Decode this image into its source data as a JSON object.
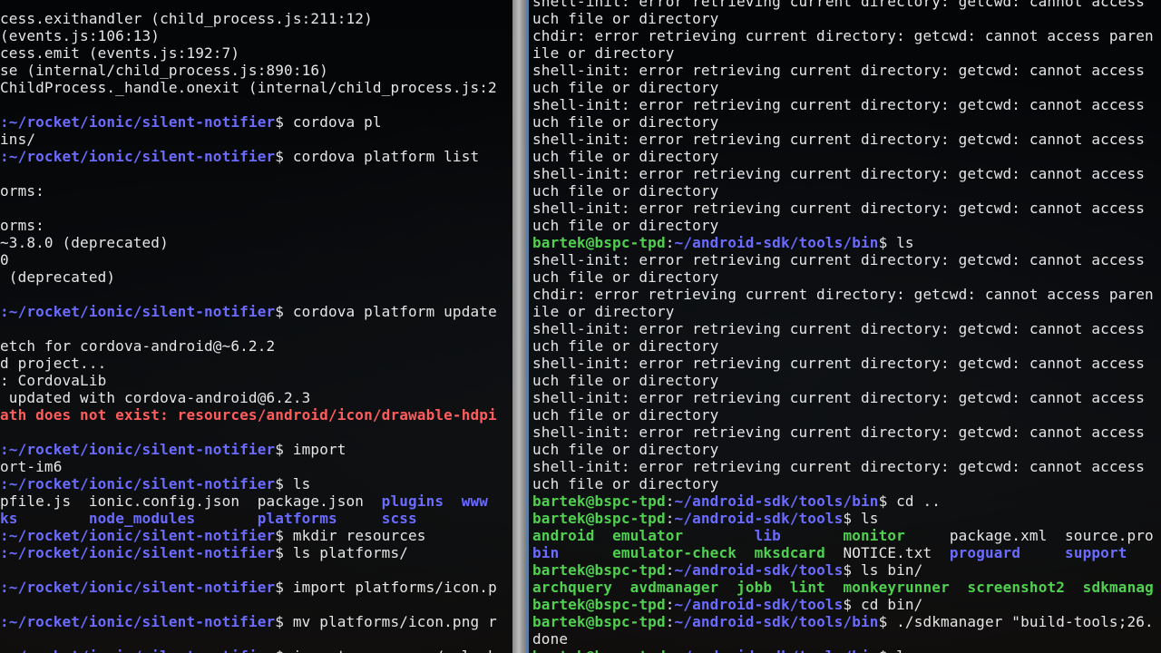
{
  "left_terminal": {
    "lines": [
      [
        {
          "t": "cess.exithandler (child_process.js:211:12)",
          "c": "t"
        }
      ],
      [
        {
          "t": "(events.js:106:13)",
          "c": "t"
        }
      ],
      [
        {
          "t": "cess.emit (events.js:192:7)",
          "c": "t"
        }
      ],
      [
        {
          "t": "se (internal/child_process.js:890:16)",
          "c": "t"
        }
      ],
      [
        {
          "t": "ChildProcess._handle.onexit (internal/child_process.js:2",
          "c": "t"
        }
      ],
      [
        {
          "t": "",
          "c": "t"
        }
      ],
      [
        {
          "t": ":~/rocket/ionic/silent-notifier",
          "c": "p"
        },
        {
          "t": "$ cordova pl",
          "c": "t"
        }
      ],
      [
        {
          "t": "ins/",
          "c": "t"
        }
      ],
      [
        {
          "t": ":~/rocket/ionic/silent-notifier",
          "c": "p"
        },
        {
          "t": "$ cordova platform list",
          "c": "t"
        }
      ],
      [
        {
          "t": "",
          "c": "t"
        }
      ],
      [
        {
          "t": "orms:",
          "c": "t"
        }
      ],
      [
        {
          "t": "",
          "c": "t"
        }
      ],
      [
        {
          "t": "orms:",
          "c": "t"
        }
      ],
      [
        {
          "t": "~3.8.0 (deprecated)",
          "c": "t"
        }
      ],
      [
        {
          "t": "0",
          "c": "t"
        }
      ],
      [
        {
          "t": " (deprecated)",
          "c": "t"
        }
      ],
      [
        {
          "t": "",
          "c": "t"
        }
      ],
      [
        {
          "t": ":~/rocket/ionic/silent-notifier",
          "c": "p"
        },
        {
          "t": "$ cordova platform update",
          "c": "t"
        }
      ],
      [
        {
          "t": "",
          "c": "t"
        }
      ],
      [
        {
          "t": "etch for cordova-android@~6.2.2",
          "c": "t"
        }
      ],
      [
        {
          "t": "d project...",
          "c": "t"
        }
      ],
      [
        {
          "t": ": CordovaLib",
          "c": "t"
        }
      ],
      [
        {
          "t": " updated with cordova-android@6.2.3",
          "c": "t"
        }
      ],
      [
        {
          "t": "ath does not exist: resources/android/icon/drawable-hdpi",
          "c": "err"
        }
      ],
      [
        {
          "t": "",
          "c": "t"
        }
      ],
      [
        {
          "t": ":~/rocket/ionic/silent-notifier",
          "c": "p"
        },
        {
          "t": "$ import",
          "c": "t"
        }
      ],
      [
        {
          "t": "ort-im6",
          "c": "t"
        }
      ],
      [
        {
          "t": ":~/rocket/ionic/silent-notifier",
          "c": "p"
        },
        {
          "t": "$ ls",
          "c": "t"
        }
      ],
      [
        {
          "t": "pfile.js  ionic.config.json  package.json  ",
          "c": "t"
        },
        {
          "t": "plugins",
          "c": "dir"
        },
        {
          "t": "  ",
          "c": "t"
        },
        {
          "t": "www",
          "c": "dir"
        }
      ],
      [
        {
          "t": "ks",
          "c": "dir"
        },
        {
          "t": "        ",
          "c": "t"
        },
        {
          "t": "node_modules",
          "c": "dir"
        },
        {
          "t": "       ",
          "c": "t"
        },
        {
          "t": "platforms",
          "c": "dir"
        },
        {
          "t": "     ",
          "c": "t"
        },
        {
          "t": "scss",
          "c": "dir"
        }
      ],
      [
        {
          "t": ":~/rocket/ionic/silent-notifier",
          "c": "p"
        },
        {
          "t": "$ mkdir resources",
          "c": "t"
        }
      ],
      [
        {
          "t": ":~/rocket/ionic/silent-notifier",
          "c": "p"
        },
        {
          "t": "$ ls platforms/",
          "c": "t"
        }
      ],
      [
        {
          "t": "",
          "c": "t"
        }
      ],
      [
        {
          "t": ":~/rocket/ionic/silent-notifier",
          "c": "p"
        },
        {
          "t": "$ import platforms/icon.p",
          "c": "t"
        }
      ],
      [
        {
          "t": "",
          "c": "t"
        }
      ],
      [
        {
          "t": ":~/rocket/ionic/silent-notifier",
          "c": "p"
        },
        {
          "t": "$ mv platforms/icon.png r",
          "c": "t"
        }
      ],
      [
        {
          "t": "",
          "c": "t"
        }
      ],
      [
        {
          "t": ":~/rocket/ionic/silent-notifier",
          "c": "p"
        },
        {
          "t": "$ import resources/splash",
          "c": "t"
        }
      ]
    ]
  },
  "right_terminal": {
    "lines": [
      [
        {
          "t": "shell-init: error retrieving current directory: getcwd: cannot access",
          "c": "t"
        }
      ],
      [
        {
          "t": "uch file or directory",
          "c": "t"
        }
      ],
      [
        {
          "t": "chdir: error retrieving current directory: getcwd: cannot access paren",
          "c": "t"
        }
      ],
      [
        {
          "t": "ile or directory",
          "c": "t"
        }
      ],
      [
        {
          "t": "shell-init: error retrieving current directory: getcwd: cannot access",
          "c": "t"
        }
      ],
      [
        {
          "t": "uch file or directory",
          "c": "t"
        }
      ],
      [
        {
          "t": "shell-init: error retrieving current directory: getcwd: cannot access",
          "c": "t"
        }
      ],
      [
        {
          "t": "uch file or directory",
          "c": "t"
        }
      ],
      [
        {
          "t": "shell-init: error retrieving current directory: getcwd: cannot access",
          "c": "t"
        }
      ],
      [
        {
          "t": "uch file or directory",
          "c": "t"
        }
      ],
      [
        {
          "t": "shell-init: error retrieving current directory: getcwd: cannot access",
          "c": "t"
        }
      ],
      [
        {
          "t": "uch file or directory",
          "c": "t"
        }
      ],
      [
        {
          "t": "shell-init: error retrieving current directory: getcwd: cannot access",
          "c": "t"
        }
      ],
      [
        {
          "t": "uch file or directory",
          "c": "t"
        }
      ],
      [
        {
          "t": "bartek@bspc-tpd",
          "c": "u"
        },
        {
          "t": ":",
          "c": "t"
        },
        {
          "t": "~/android-sdk/tools/bin",
          "c": "p"
        },
        {
          "t": "$ ls",
          "c": "t"
        }
      ],
      [
        {
          "t": "shell-init: error retrieving current directory: getcwd: cannot access",
          "c": "t"
        }
      ],
      [
        {
          "t": "uch file or directory",
          "c": "t"
        }
      ],
      [
        {
          "t": "chdir: error retrieving current directory: getcwd: cannot access paren",
          "c": "t"
        }
      ],
      [
        {
          "t": "ile or directory",
          "c": "t"
        }
      ],
      [
        {
          "t": "shell-init: error retrieving current directory: getcwd: cannot access",
          "c": "t"
        }
      ],
      [
        {
          "t": "uch file or directory",
          "c": "t"
        }
      ],
      [
        {
          "t": "shell-init: error retrieving current directory: getcwd: cannot access",
          "c": "t"
        }
      ],
      [
        {
          "t": "uch file or directory",
          "c": "t"
        }
      ],
      [
        {
          "t": "shell-init: error retrieving current directory: getcwd: cannot access",
          "c": "t"
        }
      ],
      [
        {
          "t": "uch file or directory",
          "c": "t"
        }
      ],
      [
        {
          "t": "shell-init: error retrieving current directory: getcwd: cannot access",
          "c": "t"
        }
      ],
      [
        {
          "t": "uch file or directory",
          "c": "t"
        }
      ],
      [
        {
          "t": "shell-init: error retrieving current directory: getcwd: cannot access",
          "c": "t"
        }
      ],
      [
        {
          "t": "uch file or directory",
          "c": "t"
        }
      ],
      [
        {
          "t": "bartek@bspc-tpd",
          "c": "u"
        },
        {
          "t": ":",
          "c": "t"
        },
        {
          "t": "~/android-sdk/tools/bin",
          "c": "p"
        },
        {
          "t": "$ cd ..",
          "c": "t"
        }
      ],
      [
        {
          "t": "bartek@bspc-tpd",
          "c": "u"
        },
        {
          "t": ":",
          "c": "t"
        },
        {
          "t": "~/android-sdk/tools",
          "c": "p"
        },
        {
          "t": "$ ls",
          "c": "t"
        }
      ],
      [
        {
          "t": "android",
          "c": "gdir"
        },
        {
          "t": "  ",
          "c": "t"
        },
        {
          "t": "emulator",
          "c": "gdir"
        },
        {
          "t": "        ",
          "c": "t"
        },
        {
          "t": "lib",
          "c": "dir"
        },
        {
          "t": "       ",
          "c": "t"
        },
        {
          "t": "monitor",
          "c": "gdir"
        },
        {
          "t": "     package.xml  source.pro",
          "c": "t"
        }
      ],
      [
        {
          "t": "bin",
          "c": "dir"
        },
        {
          "t": "      ",
          "c": "t"
        },
        {
          "t": "emulator-check",
          "c": "gdir"
        },
        {
          "t": "  ",
          "c": "t"
        },
        {
          "t": "mksdcard",
          "c": "gdir"
        },
        {
          "t": "  NOTICE.txt  ",
          "c": "t"
        },
        {
          "t": "proguard",
          "c": "dir"
        },
        {
          "t": "     ",
          "c": "t"
        },
        {
          "t": "support",
          "c": "dir"
        }
      ],
      [
        {
          "t": "bartek@bspc-tpd",
          "c": "u"
        },
        {
          "t": ":",
          "c": "t"
        },
        {
          "t": "~/android-sdk/tools",
          "c": "p"
        },
        {
          "t": "$ ls bin/",
          "c": "t"
        }
      ],
      [
        {
          "t": "archquery",
          "c": "gdir"
        },
        {
          "t": "  ",
          "c": "t"
        },
        {
          "t": "avdmanager",
          "c": "gdir"
        },
        {
          "t": "  ",
          "c": "t"
        },
        {
          "t": "jobb",
          "c": "gdir"
        },
        {
          "t": "  ",
          "c": "t"
        },
        {
          "t": "lint",
          "c": "gdir"
        },
        {
          "t": "  ",
          "c": "t"
        },
        {
          "t": "monkeyrunner",
          "c": "gdir"
        },
        {
          "t": "  ",
          "c": "t"
        },
        {
          "t": "screenshot2",
          "c": "gdir"
        },
        {
          "t": "  ",
          "c": "t"
        },
        {
          "t": "sdkmanag",
          "c": "gdir"
        }
      ],
      [
        {
          "t": "bartek@bspc-tpd",
          "c": "u"
        },
        {
          "t": ":",
          "c": "t"
        },
        {
          "t": "~/android-sdk/tools",
          "c": "p"
        },
        {
          "t": "$ cd bin/",
          "c": "t"
        }
      ],
      [
        {
          "t": "bartek@bspc-tpd",
          "c": "u"
        },
        {
          "t": ":",
          "c": "t"
        },
        {
          "t": "~/android-sdk/tools/bin",
          "c": "p"
        },
        {
          "t": "$ ./sdkmanager \"build-tools;26.",
          "c": "t"
        }
      ],
      [
        {
          "t": "done",
          "c": "t"
        }
      ],
      [
        {
          "t": "bartek@bspc-tpd",
          "c": "u"
        },
        {
          "t": ":",
          "c": "t"
        },
        {
          "t": "~/android-sdk/tools/bin",
          "c": "p"
        },
        {
          "t": "$ ls",
          "c": "t"
        }
      ]
    ]
  }
}
